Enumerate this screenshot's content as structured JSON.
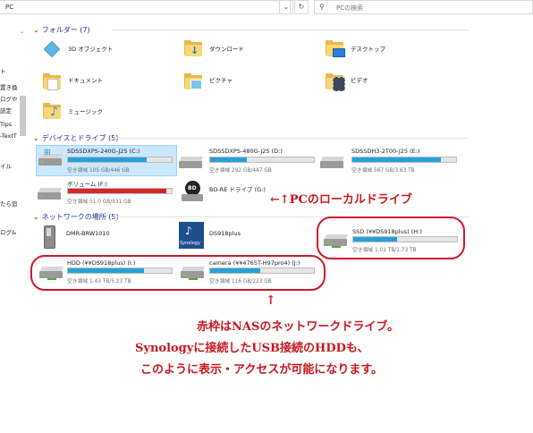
{
  "address": {
    "path": "PC",
    "dropdown_icon": "chevron-down-icon",
    "refresh_icon": "refresh-icon"
  },
  "search": {
    "placeholder": "PCの検索",
    "icon": "search-icon"
  },
  "sidebar": {
    "items": [
      "ト",
      "置き換",
      "ログや",
      "読定",
      "Tips",
      "-TextT",
      "イル",
      "たら追",
      "ログ&"
    ]
  },
  "groups": {
    "folders": "フォルダー (7)",
    "devices": "デバイスとドライブ (5)",
    "network": "ネットワークの場所 (5)"
  },
  "folders": [
    {
      "label": "3D オブジェクト",
      "icon": "3d-objects-icon"
    },
    {
      "label": "ダウンロード",
      "icon": "download-folder-icon"
    },
    {
      "label": "デスクトップ",
      "icon": "desktop-folder-icon"
    },
    {
      "label": "ドキュメント",
      "icon": "documents-folder-icon"
    },
    {
      "label": "ピクチャ",
      "icon": "pictures-folder-icon"
    },
    {
      "label": "ビデオ",
      "icon": "videos-folder-icon"
    },
    {
      "label": "ミュージック",
      "icon": "music-folder-icon"
    }
  ],
  "drives": [
    {
      "title": "SDSSDXPS-240G-J25 (C:)",
      "free": "空き領域 105 GB/446 GB",
      "used_fraction": 0.76,
      "bar_color": "#26a0da",
      "icon": "windows-drive-icon"
    },
    {
      "title": "SDSSDXPS-480G-J25 (D:)",
      "free": "空き領域 292 GB/447 GB",
      "used_fraction": 0.35,
      "bar_color": "#26a0da",
      "icon": "hard-drive-icon"
    },
    {
      "title": "SDSSDH3-2T00-J25 (E:)",
      "free": "空き領域 567 GB/3.63 TB",
      "used_fraction": 0.85,
      "bar_color": "#26a0da",
      "icon": "hard-drive-icon"
    },
    {
      "title": "ボリューム (F:)",
      "free": "空き領域 51.0 GB/931 GB",
      "used_fraction": 0.95,
      "bar_color": "#da2626",
      "icon": "hard-drive-icon"
    },
    {
      "title": "BD-RE ドライブ (G:)",
      "icon": "bd-drive-icon"
    }
  ],
  "network": [
    {
      "title": "DMR-BRW1010",
      "icon": "media-device-icon"
    },
    {
      "title": "DS918plus",
      "icon": "synology-device-icon",
      "brand": "Synology"
    },
    {
      "title": "SSD (¥¥DS918plus) (H:)",
      "free": "空き領域 1.01 TB/1.73 TB",
      "used_fraction": 0.42,
      "bar_color": "#26a0da",
      "icon": "network-drive-icon"
    },
    {
      "title": "HDD (¥¥DS918plus) (I:)",
      "free": "空き領域 1.43 TB/5.23 TB",
      "used_fraction": 0.73,
      "bar_color": "#26a0da",
      "icon": "network-drive-icon"
    },
    {
      "title": "camera (¥¥4765T-H97pro4) (J:)",
      "free": "空き領域 116 GB/223 GB",
      "used_fraction": 0.48,
      "bar_color": "#26a0da",
      "icon": "network-drive-icon"
    }
  ],
  "annotations": {
    "local": "←↑PCのローカルドライブ",
    "arrow_up": "↑",
    "line1": "赤枠はNASのネットワークドライブ。",
    "line2": "Synologyに接続したUSB接続のHDDも、",
    "line3": "このように表示・アクセスが可能になります。",
    "color": "#c8171e"
  }
}
